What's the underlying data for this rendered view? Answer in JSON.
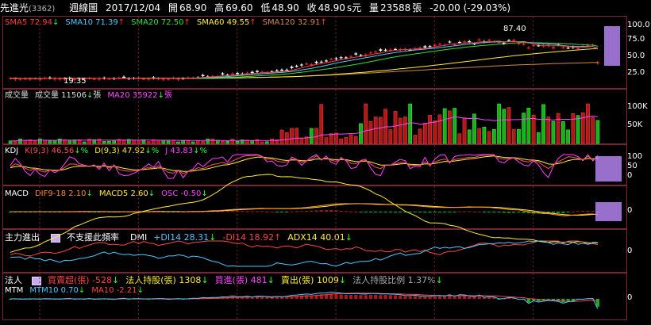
{
  "header": {
    "name": "先進光",
    "code": "(3362)",
    "period": "週線圖",
    "date": "2017/12/04",
    "open_label": "開",
    "open": "68.90",
    "high_label": "高",
    "high": "69.60",
    "low_label": "低",
    "low": "48.90",
    "close_label": "收",
    "close": "48.90",
    "unit_s": "s元",
    "vol_label": "量",
    "vol": "23588",
    "vol_unit": "張",
    "change": "-20.00 (-29.03%)"
  },
  "price": {
    "legend": [
      {
        "text": "SMA5 72.94",
        "arrow": "↓",
        "color": "#ff3b3b"
      },
      {
        "text": "SMA10 71.39",
        "arrow": "↑",
        "color": "#4fc8ff"
      },
      {
        "text": "SMA20 72.50",
        "arrow": "↑",
        "color": "#33e033"
      },
      {
        "text": "SMA60 49.55",
        "arrow": "↑",
        "color": "#ffee33"
      },
      {
        "text": "SMA120 32.91",
        "arrow": "↑",
        "color": "#d08a4a"
      }
    ],
    "axis": [
      "100.0",
      "75.0",
      "50.0",
      "25.0"
    ],
    "high_mark": "87.40",
    "low_mark": "19.35"
  },
  "volume": {
    "legend": [
      {
        "text": "成交量",
        "color": "#dddddd",
        "arrow": ""
      },
      {
        "text": "成交量 11506",
        "arrow": "↓",
        "suffix": "張",
        "color": "#dddddd"
      },
      {
        "text": "MA20 35922",
        "arrow": "↓",
        "suffix": "張",
        "color": "#ff44ff"
      }
    ],
    "axis": [
      "100K",
      "50K"
    ]
  },
  "kdj": {
    "legend": [
      {
        "text": "KDJ",
        "color": "#ffffff",
        "arrow": ""
      },
      {
        "text": "K(9,3) 46.56",
        "arrow": "↓%",
        "color": "#ff5050"
      },
      {
        "text": "D(9,3) 47.92",
        "arrow": "↓%",
        "color": "#ffee33"
      },
      {
        "text": "J 43.83",
        "arrow": "↓%",
        "color": "#ff44ff"
      }
    ],
    "axis": [
      "100",
      "50",
      "0"
    ]
  },
  "macd": {
    "legend": [
      {
        "text": "MACD",
        "color": "#ffffff",
        "arrow": ""
      },
      {
        "text": "DIF9-18 2.10",
        "arrow": "↓",
        "color": "#ff8a3a"
      },
      {
        "text": "MACD5 2.60",
        "arrow": "↓",
        "color": "#ffee33"
      },
      {
        "text": "OSC -0.50",
        "arrow": "↓",
        "color": "#ff44ff"
      }
    ],
    "axis": [
      "0"
    ]
  },
  "dmi": {
    "title": "主力進出",
    "sub": "不支援此頻率",
    "legend": [
      {
        "text": "DMI",
        "color": "#ffffff",
        "arrow": ""
      },
      {
        "text": "+DI14 28.31",
        "arrow": "↓",
        "color": "#4fc8ff"
      },
      {
        "text": "-DI14 18.92",
        "arrow": "↑",
        "color": "#ff4444"
      },
      {
        "text": "ADX14 40.01",
        "arrow": "↓",
        "color": "#ffee33"
      }
    ],
    "axis": [
      "0"
    ]
  },
  "inst": {
    "title": "法人",
    "legend": [
      {
        "text": "買賣超(張) -528",
        "arrow": "↓",
        "color": "#ff4444"
      },
      {
        "text": "法人持股(張) 1308",
        "arrow": "↓",
        "color": "#ffee33"
      },
      {
        "text": "買進(張) 481",
        "arrow": "↓",
        "color": "#ff44ff"
      },
      {
        "text": "賣出(張) 1009",
        "arrow": "↓",
        "color": "#ffee33"
      },
      {
        "text": "法人持股比例 1.37%",
        "arrow": "↓",
        "color": "#aaaaaa"
      }
    ]
  },
  "mtm": {
    "legend": [
      {
        "text": "MTM",
        "color": "#ffffff",
        "arrow": ""
      },
      {
        "text": "MTM10 0.70",
        "arrow": "↓",
        "color": "#4fc8ff"
      },
      {
        "text": "MA10 -2.21",
        "arrow": "↓",
        "color": "#ff4444"
      }
    ],
    "axis": [
      "0"
    ]
  }
}
